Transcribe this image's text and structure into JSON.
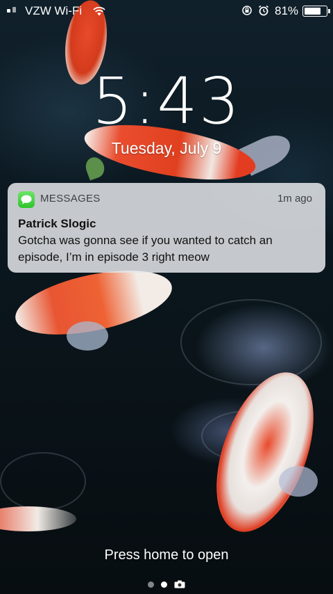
{
  "status_bar": {
    "carrier": "VZW Wi-Fi",
    "battery_percent": "81%",
    "battery_level": 0.81,
    "icons": [
      "signal-icon",
      "wifi-icon",
      "rotation-lock-icon",
      "alarm-icon",
      "battery-icon"
    ]
  },
  "lock_screen": {
    "time": "5:43",
    "date": "Tuesday, July 9"
  },
  "notification": {
    "app_name": "MESSAGES",
    "app_icon": "messages-icon",
    "timestamp": "1m ago",
    "sender": "Patrick Slogic",
    "body": "Gotcha was gonna see if you wanted to catch an episode, I’m in episode 3 right meow"
  },
  "footer": {
    "hint": "Press home to open",
    "pages": [
      "dot",
      "dot-active",
      "camera"
    ]
  },
  "colors": {
    "messages_green": "#34c759",
    "notification_bg": "#e4e6ea"
  }
}
